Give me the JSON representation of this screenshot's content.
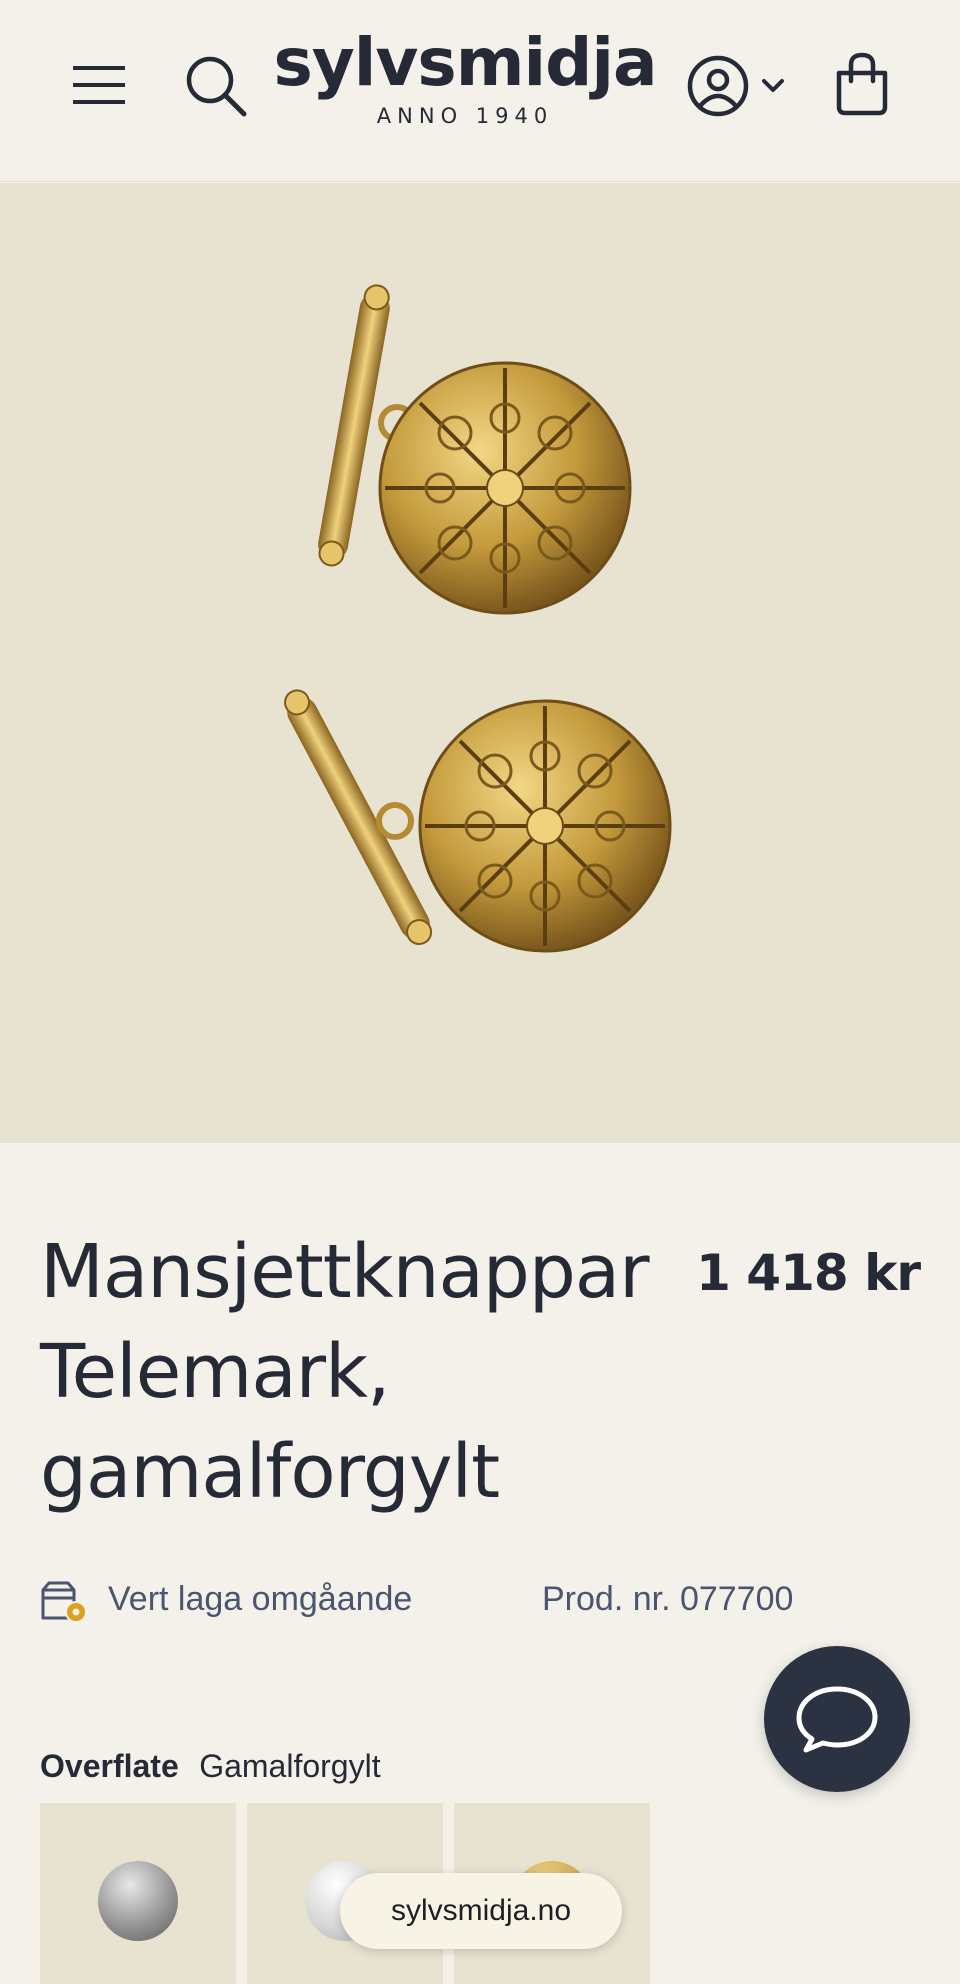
{
  "header": {
    "logo_text": "sylvsmidja",
    "logo_sub": "ANNO 1940",
    "menu_icon": "hamburger-menu-icon",
    "search_icon": "search-icon",
    "account_icon": "user-circle-icon",
    "cart_icon": "shopping-bag-icon"
  },
  "product": {
    "image_alt": "Gilded filigree cufflinks",
    "title_line1": "Mansjettknappar",
    "title_line2": "Telemark,",
    "title_line3": "gamalforgylt",
    "price": "1 418 kr",
    "stock_text": "Vert laga omgåande",
    "product_number": "Prod. nr. 077700"
  },
  "options": {
    "finish_label": "Overflate",
    "finish_value": "Gamalforgylt",
    "swatches": [
      {
        "name": "Sølv",
        "color": "#9a9a9a"
      },
      {
        "name": "Kvit",
        "color": "#d9d9d9"
      },
      {
        "name": "Gamalforgylt",
        "color": "#c9a24a"
      }
    ]
  },
  "chat": {
    "icon": "chat-bubble-icon"
  },
  "browser": {
    "domain": "sylvsmidja.no"
  },
  "colors": {
    "background": "#f3f1ea",
    "image_bg": "#e8e2d0",
    "text_dark": "#252a36",
    "text_muted": "#4b5570",
    "chat_bg": "#2b3242",
    "gold": "#c9a24a"
  }
}
